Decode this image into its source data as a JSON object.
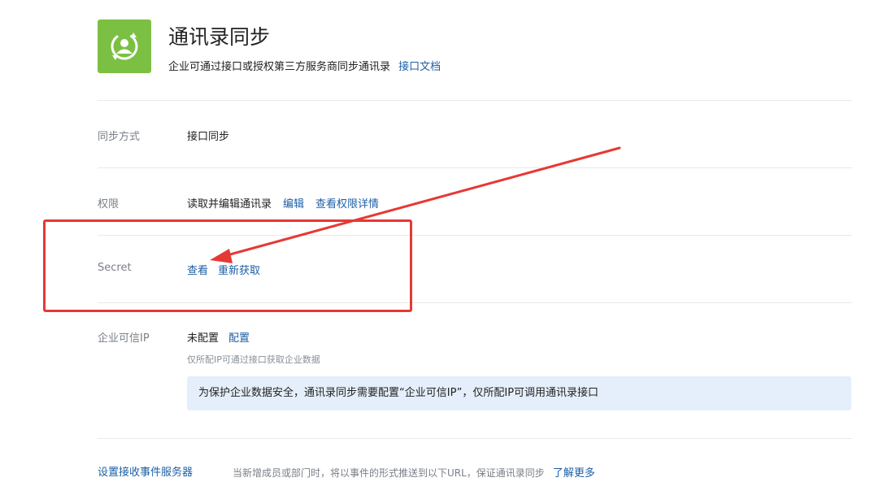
{
  "header": {
    "icon": "contacts-sync-icon",
    "icon_color": "#7bc043",
    "title": "通讯录同步",
    "description": "企业可通过接口或授权第三方服务商同步通讯录",
    "doc_link": "接口文档"
  },
  "rows": {
    "sync_method": {
      "label": "同步方式",
      "value": "接口同步"
    },
    "permission": {
      "label": "权限",
      "value": "读取并编辑通讯录",
      "edit_link": "编辑",
      "details_link": "查看权限详情"
    },
    "secret": {
      "label": "Secret",
      "view_link": "查看",
      "reacquire_link": "重新获取"
    },
    "trusted_ip": {
      "label": "企业可信IP",
      "value": "未配置",
      "config_link": "配置",
      "hint": "仅所配IP可通过接口获取企业数据",
      "notice": "为保护企业数据安全，通讯录同步需要配置“企业可信IP”，仅所配IP可调用通讯录接口"
    }
  },
  "footer": {
    "label": "设置接收事件服务器",
    "description": "当新增成员或部门时，将以事件的形式推送到以下URL，保证通讯录同步",
    "learn_more": "了解更多"
  },
  "annotation": {
    "color": "#e53935"
  }
}
